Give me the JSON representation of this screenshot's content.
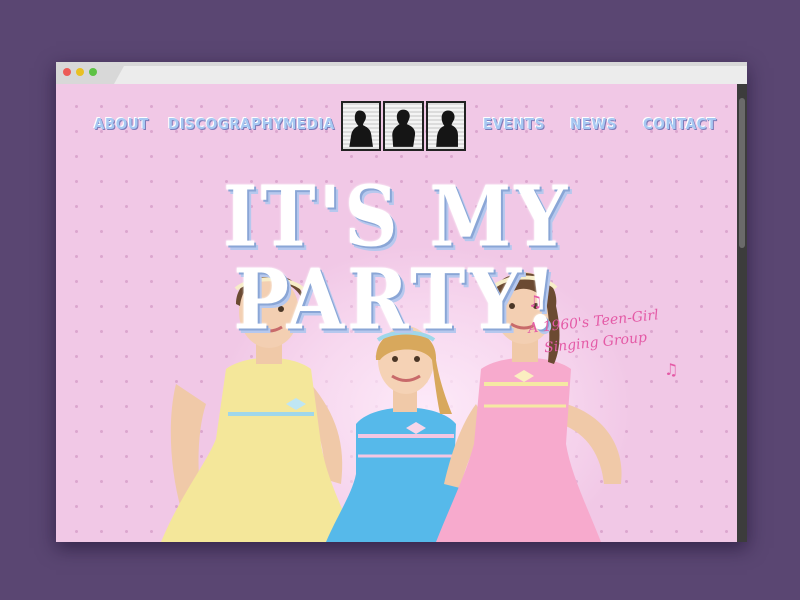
{
  "browser": {
    "traffic_lights": [
      "#ec5b57",
      "#e8c023",
      "#5dc244"
    ]
  },
  "nav": {
    "items": [
      {
        "label": "ABOUT"
      },
      {
        "label": "DISCOGRAPHY"
      },
      {
        "label": "MEDIA"
      },
      {
        "label": "EVENTS"
      },
      {
        "label": "NEWS"
      },
      {
        "label": "CONTACT"
      }
    ],
    "logo_icon": "three-silhouettes-logo-icon"
  },
  "hero": {
    "headline": "IT'S MY PARTY!",
    "tagline_line1": "A 1960's Teen-Girl",
    "tagline_line2": "Singing Group",
    "note_glyph": "♫",
    "colors": {
      "background": "#f1c8e6",
      "nav_text": "#a7c8f2",
      "tagline": "#e45aa6",
      "dress_yellow": "#f4e79a",
      "dress_blue": "#56b9ea",
      "dress_pink": "#f7aacd"
    }
  }
}
